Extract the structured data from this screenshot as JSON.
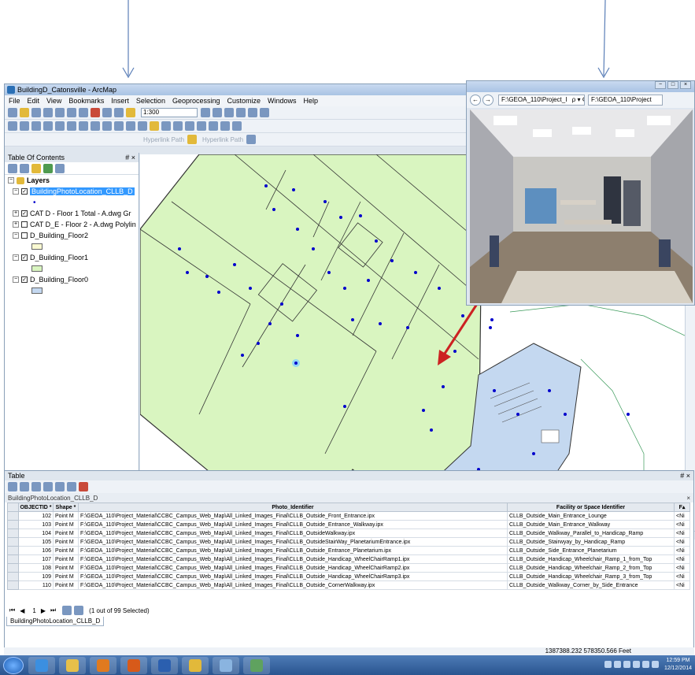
{
  "window": {
    "title": "BuildingD_Catonsville - ArcMap"
  },
  "menu": [
    "File",
    "Edit",
    "View",
    "Bookmarks",
    "Insert",
    "Selection",
    "Geoprocessing",
    "Customize",
    "Windows",
    "Help"
  ],
  "toolbar": {
    "scale": "1:300",
    "hyperlink_path_1": "Hyperlink Path",
    "hyperlink_path_2": "Hyperlink Path"
  },
  "toc": {
    "title": "Table Of Contents",
    "pin": "# ×",
    "layers_label": "Layers",
    "items": [
      {
        "label": "BuildingPhotoLocation_CLLB_D",
        "checked": true,
        "selected": true
      },
      {
        "label": "CAT D - Floor 1 Total - A.dwg Gr",
        "checked": true,
        "selected": false
      },
      {
        "label": "CAT D_E - Floor 2 - A.dwg Polylin",
        "checked": false,
        "selected": false
      },
      {
        "label": "D_Building_Floor2",
        "checked": false,
        "selected": false
      },
      {
        "label": "D_Building_Floor1",
        "checked": true,
        "selected": false
      },
      {
        "label": "D_Building_Floor0",
        "checked": true,
        "selected": false
      }
    ],
    "swatch_colors": [
      "#fafad2",
      "#d9f5c0",
      "#c4d8f0"
    ]
  },
  "photo_viewer": {
    "address": "F:\\GEOA_110\\Project_I",
    "address_icons": "ρ ▾ ¢",
    "tab_label": "F:\\GEOA_110\\Project"
  },
  "table": {
    "title": "Table",
    "pin": "# ×",
    "layer_name": "BuildingPhotoLocation_CLLB_D",
    "close": "×",
    "columns": [
      "OBJECTID *",
      "Shape *",
      "Photo_Identifier",
      "Facility or Space Identifier",
      "F▴"
    ],
    "rows": [
      [
        "102",
        "Point M",
        "F:\\GEOA_110\\Project_Material\\CCBC_Campus_Web_Map\\All_Linked_Images_Final\\CLLB_Outside_Front_Entrance.ipx",
        "CLLB_Outside_Main_Entrance_Lounge",
        "<Ni"
      ],
      [
        "103",
        "Point M",
        "F:\\GEOA_110\\Project_Material\\CCBC_Campus_Web_Map\\All_Linked_Images_Final\\CLLB_Outside_Entrance_Walkway.ipx",
        "CLLB_Outside_Main_Entrance_Walkway",
        "<Ni"
      ],
      [
        "104",
        "Point M",
        "F:\\GEOA_110\\Project_Material\\CCBC_Campus_Web_Map\\All_Linked_Images_Final\\CLLB_OutsideWalkway.ipx",
        "CLLB_Outside_Walkway_Parallel_to_Handicap_Ramp",
        "<Ni"
      ],
      [
        "105",
        "Point M",
        "F:\\GEOA_110\\Project_Material\\CCBC_Campus_Web_Map\\All_Linked_Images_Final\\CLLB_OutsideStairWay_PlanetariumEntrance.ipx",
        "CLLB_Outside_Stairwyay_by_Handicap_Ramp",
        "<Ni"
      ],
      [
        "106",
        "Point M",
        "F:\\GEOA_110\\Project_Material\\CCBC_Campus_Web_Map\\All_Linked_Images_Final\\CLLB_Outside_Entrance_Planetarium.ipx",
        "CLLB_Outside_Side_Entrance_Planetarium",
        "<Ni"
      ],
      [
        "107",
        "Point M",
        "F:\\GEOA_110\\Project_Material\\CCBC_Campus_Web_Map\\All_Linked_Images_Final\\CLLB_Outside_Handicap_WheelChairRamp1.ipx",
        "CLLB_Outside_Handicap_Wheelchair_Ramp_1_from_Top",
        "<Ni"
      ],
      [
        "108",
        "Point M",
        "F:\\GEOA_110\\Project_Material\\CCBC_Campus_Web_Map\\All_Linked_Images_Final\\CLLB_Outside_Handicap_WheelChairRamp2.ipx",
        "CLLB_Outside_Handicap_Wheelchair_Ramp_2_from_Top",
        "<Ni"
      ],
      [
        "109",
        "Point M",
        "F:\\GEOA_110\\Project_Material\\CCBC_Campus_Web_Map\\All_Linked_Images_Final\\CLLB_Outside_Handicap_WheelChairRamp3.ipx",
        "CLLB_Outside_Handicap_Wheelchair_Ramp_3_from_Top",
        "<Ni"
      ],
      [
        "110",
        "Point M",
        "F:\\GEOA_110\\Project_Material\\CCBC_Campus_Web_Map\\All_Linked_Images_Final\\CLLB_Outside_CornerWalkway.ipx",
        "CLLB_Outside_Walkway_Corner_by_Side_Entrance",
        "<Ni"
      ]
    ],
    "nav_position": "1",
    "selection_status": "(1 out of 99 Selected)",
    "tab_label": "BuildingPhotoLocation_CLLB_D"
  },
  "status": {
    "coordinates": "1387388.232  578350.566 Feet"
  },
  "taskbar": {
    "time": "12:59 PM",
    "date": "12/12/2014"
  },
  "colors": {
    "floor_green": "#d9f5c0",
    "floor_blue": "#c4d8f0",
    "point_blue": "#0000cc",
    "arrow_red": "#cc2222",
    "selection_blue": "#3399ff"
  }
}
